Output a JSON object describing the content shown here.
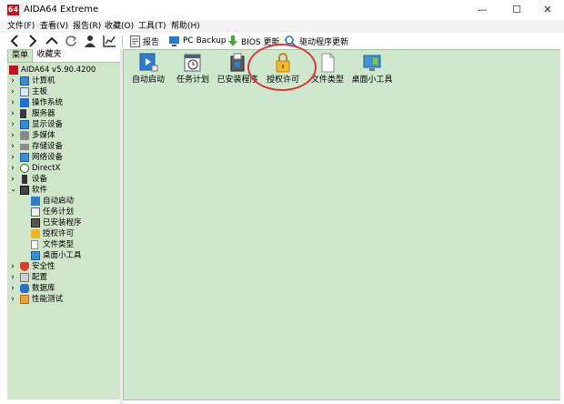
{
  "window": {
    "title": "AIDA64 Extreme",
    "logo_text": "64"
  },
  "menu": [
    "文件(F)",
    "查看(V)",
    "报告(R)",
    "收藏(O)",
    "工具(T)",
    "帮助(H)"
  ],
  "toolbar": {
    "report_label": "报告",
    "pcbackup_label": "PC Backup",
    "bios_label": "BIOS 更新",
    "driver_label": "驱动程序更新"
  },
  "tabs": [
    "菜单",
    "收藏夹"
  ],
  "tree": {
    "root": "AIDA64 v5.90.4200",
    "items": [
      "计算机",
      "主板",
      "操作系统",
      "服务器",
      "显示设备",
      "多媒体",
      "存储设备",
      "网络设备",
      "DirectX",
      "设备",
      "软件"
    ],
    "software_children": [
      "自动启动",
      "任务计划",
      "已安装程序",
      "授权许可",
      "文件类型",
      "桌面小工具"
    ],
    "items_after": [
      "安全性",
      "配置",
      "数据库",
      "性能测试"
    ]
  },
  "content": {
    "tiles": [
      "自动启动",
      "任务计划",
      "已安装程序",
      "授权许可",
      "文件类型",
      "桌面小工具"
    ]
  },
  "colors": {
    "accent_red": "#c8101e",
    "panel_green": "#cde8cd",
    "highlight_circle": "#e0353b"
  }
}
